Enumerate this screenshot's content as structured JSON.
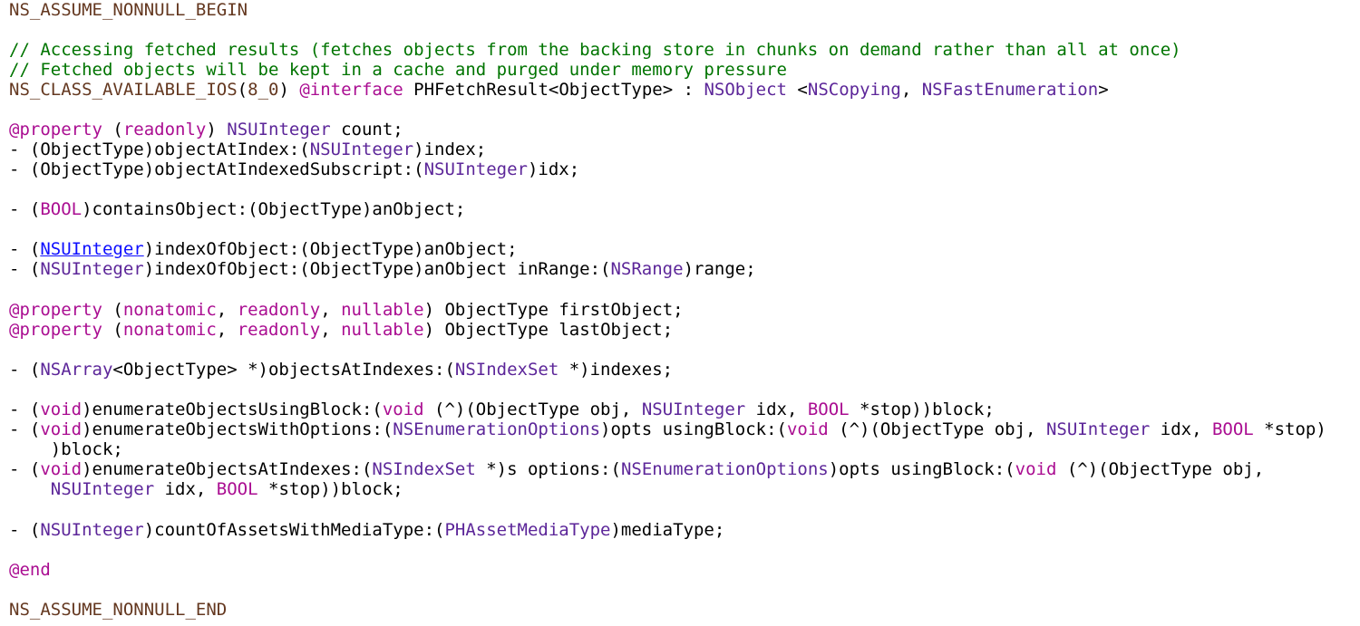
{
  "colors": {
    "background": "#ffffff",
    "plain": "#000000",
    "macro": "#643820",
    "comment": "#007400",
    "keyword": "#aa0d91",
    "type": "#5c2699",
    "number": "#1c00cf",
    "link": "#0e0eff"
  },
  "code_lines": [
    {
      "tokens": [
        {
          "t": "NS_ASSUME_NONNULL_BEGIN",
          "c": "macro"
        }
      ]
    },
    {
      "tokens": [
        {
          "t": "// Accessing fetched results (fetches objects from the backing store in chunks on demand rather than all at once)",
          "c": "comment"
        }
      ]
    },
    {
      "tokens": [
        {
          "t": "// Fetched objects will be kept in a cache and purged under memory pressure",
          "c": "comment"
        }
      ]
    },
    {
      "tokens": [
        {
          "t": "NS_CLASS_AVAILABLE_IOS",
          "c": "macro"
        },
        {
          "t": "(",
          "c": "plain"
        },
        {
          "t": "8_0",
          "c": "macro"
        },
        {
          "t": ") ",
          "c": "plain"
        },
        {
          "t": "@interface",
          "c": "keyword"
        },
        {
          "t": " PHFetchResult<ObjectType> : ",
          "c": "plain"
        },
        {
          "t": "NSObject",
          "c": "type"
        },
        {
          "t": " <",
          "c": "plain"
        },
        {
          "t": "NSCopying",
          "c": "type"
        },
        {
          "t": ", ",
          "c": "plain"
        },
        {
          "t": "NSFastEnumeration",
          "c": "type"
        },
        {
          "t": ">",
          "c": "plain"
        }
      ]
    },
    {
      "tokens": [
        {
          "t": "@property",
          "c": "keyword"
        },
        {
          "t": " (",
          "c": "plain"
        },
        {
          "t": "readonly",
          "c": "keyword"
        },
        {
          "t": ") ",
          "c": "plain"
        },
        {
          "t": "NSUInteger",
          "c": "type"
        },
        {
          "t": " count;",
          "c": "plain"
        }
      ]
    },
    {
      "tokens": [
        {
          "t": "- (ObjectType)objectAtIndex:(",
          "c": "plain"
        },
        {
          "t": "NSUInteger",
          "c": "type"
        },
        {
          "t": ")index;",
          "c": "plain"
        }
      ]
    },
    {
      "tokens": [
        {
          "t": "- (ObjectType)objectAtIndexedSubscript:(",
          "c": "plain"
        },
        {
          "t": "NSUInteger",
          "c": "type"
        },
        {
          "t": ")idx;",
          "c": "plain"
        }
      ]
    },
    {
      "tokens": [
        {
          "t": "- (",
          "c": "plain"
        },
        {
          "t": "BOOL",
          "c": "keyword"
        },
        {
          "t": ")containsObject:(ObjectType)anObject;",
          "c": "plain"
        }
      ]
    },
    {
      "tokens": [
        {
          "t": "- (",
          "c": "plain"
        },
        {
          "t": "NSUInteger",
          "c": "link"
        },
        {
          "t": ")indexOfObject:(ObjectType)anObject;",
          "c": "plain"
        }
      ]
    },
    {
      "tokens": [
        {
          "t": "- (",
          "c": "plain"
        },
        {
          "t": "NSUInteger",
          "c": "type"
        },
        {
          "t": ")indexOfObject:(ObjectType)anObject inRange:(",
          "c": "plain"
        },
        {
          "t": "NSRange",
          "c": "type"
        },
        {
          "t": ")range;",
          "c": "plain"
        }
      ]
    },
    {
      "tokens": [
        {
          "t": "@property",
          "c": "keyword"
        },
        {
          "t": " (",
          "c": "plain"
        },
        {
          "t": "nonatomic",
          "c": "keyword"
        },
        {
          "t": ", ",
          "c": "plain"
        },
        {
          "t": "readonly",
          "c": "keyword"
        },
        {
          "t": ", ",
          "c": "plain"
        },
        {
          "t": "nullable",
          "c": "keyword"
        },
        {
          "t": ") ObjectType firstObject;",
          "c": "plain"
        }
      ]
    },
    {
      "tokens": [
        {
          "t": "@property",
          "c": "keyword"
        },
        {
          "t": " (",
          "c": "plain"
        },
        {
          "t": "nonatomic",
          "c": "keyword"
        },
        {
          "t": ", ",
          "c": "plain"
        },
        {
          "t": "readonly",
          "c": "keyword"
        },
        {
          "t": ", ",
          "c": "plain"
        },
        {
          "t": "nullable",
          "c": "keyword"
        },
        {
          "t": ") ObjectType lastObject;",
          "c": "plain"
        }
      ]
    },
    {
      "tokens": [
        {
          "t": "- (",
          "c": "plain"
        },
        {
          "t": "NSArray",
          "c": "type"
        },
        {
          "t": "<ObjectType> *)objectsAtIndexes:(",
          "c": "plain"
        },
        {
          "t": "NSIndexSet",
          "c": "type"
        },
        {
          "t": " *)indexes;",
          "c": "plain"
        }
      ]
    },
    {
      "tokens": [
        {
          "t": "- (",
          "c": "plain"
        },
        {
          "t": "void",
          "c": "keyword"
        },
        {
          "t": ")enumerateObjectsUsingBlock:(",
          "c": "plain"
        },
        {
          "t": "void",
          "c": "keyword"
        },
        {
          "t": " (^)(ObjectType obj, ",
          "c": "plain"
        },
        {
          "t": "NSUInteger",
          "c": "type"
        },
        {
          "t": " idx, ",
          "c": "plain"
        },
        {
          "t": "BOOL",
          "c": "keyword"
        },
        {
          "t": " *stop))block;",
          "c": "plain"
        }
      ]
    },
    {
      "tokens": [
        {
          "t": "- (",
          "c": "plain"
        },
        {
          "t": "void",
          "c": "keyword"
        },
        {
          "t": ")enumerateObjectsWithOptions:(",
          "c": "plain"
        },
        {
          "t": "NSEnumerationOptions",
          "c": "type"
        },
        {
          "t": ")opts usingBlock:(",
          "c": "plain"
        },
        {
          "t": "void",
          "c": "keyword"
        },
        {
          "t": " (^)(ObjectType obj, ",
          "c": "plain"
        },
        {
          "t": "NSUInteger",
          "c": "type"
        },
        {
          "t": " idx, ",
          "c": "plain"
        },
        {
          "t": "BOOL",
          "c": "keyword"
        },
        {
          "t": " *stop)",
          "c": "plain"
        }
      ]
    },
    {
      "tokens": [
        {
          "t": "    )block;",
          "c": "plain"
        }
      ]
    },
    {
      "tokens": [
        {
          "t": "- (",
          "c": "plain"
        },
        {
          "t": "void",
          "c": "keyword"
        },
        {
          "t": ")enumerateObjectsAtIndexes:(",
          "c": "plain"
        },
        {
          "t": "NSIndexSet",
          "c": "type"
        },
        {
          "t": " *)s options:(",
          "c": "plain"
        },
        {
          "t": "NSEnumerationOptions",
          "c": "type"
        },
        {
          "t": ")opts usingBlock:(",
          "c": "plain"
        },
        {
          "t": "void",
          "c": "keyword"
        },
        {
          "t": " (^)(ObjectType obj,",
          "c": "plain"
        }
      ]
    },
    {
      "tokens": [
        {
          "t": "    ",
          "c": "plain"
        },
        {
          "t": "NSUInteger",
          "c": "type"
        },
        {
          "t": " idx, ",
          "c": "plain"
        },
        {
          "t": "BOOL",
          "c": "keyword"
        },
        {
          "t": " *stop))block;",
          "c": "plain"
        }
      ]
    },
    {
      "tokens": [
        {
          "t": "- (",
          "c": "plain"
        },
        {
          "t": "NSUInteger",
          "c": "type"
        },
        {
          "t": ")countOfAssetsWithMediaType:(",
          "c": "plain"
        },
        {
          "t": "PHAssetMediaType",
          "c": "type"
        },
        {
          "t": ")mediaType;",
          "c": "plain"
        }
      ]
    },
    {
      "tokens": [
        {
          "t": "@end",
          "c": "keyword"
        }
      ]
    },
    {
      "tokens": [
        {
          "t": "NS_ASSUME_NONNULL_END",
          "c": "macro"
        }
      ]
    }
  ]
}
